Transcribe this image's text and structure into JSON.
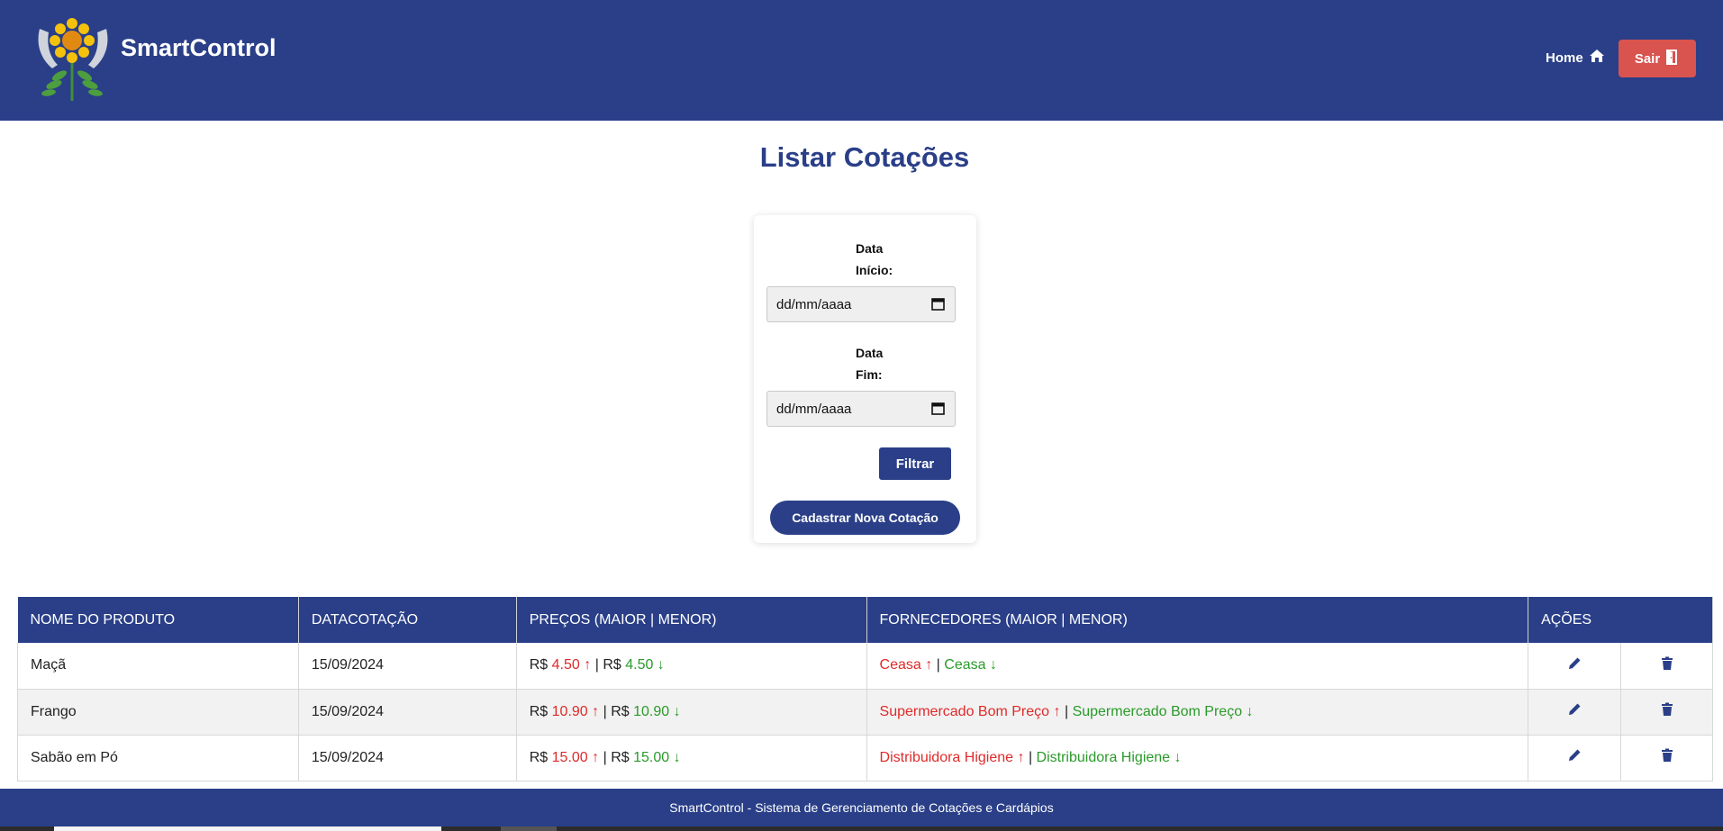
{
  "header": {
    "brand": "SmartControl",
    "home_label": "Home",
    "logout_label": "Sair"
  },
  "page": {
    "title": "Listar Cotações"
  },
  "filter": {
    "start_label_line1": "Data",
    "start_label_line2": "Início:",
    "start_value": "dd/mm/aaaa",
    "end_label_line1": "Data",
    "end_label_line2": "Fim:",
    "end_value": "dd/mm/aaaa",
    "filter_button": "Filtrar",
    "new_button": "Cadastrar Nova Cotação"
  },
  "table": {
    "columns": [
      "NOME DO PRODUTO",
      "DATACOTAÇÃO",
      "PREÇOS (MAIOR | MENOR)",
      "FORNECEDORES (MAIOR | MENOR)",
      "AÇÕES"
    ],
    "rows": [
      {
        "product": "Maçã",
        "date": "15/09/2024",
        "currency": "R$",
        "price_high": "4.50 ↑",
        "sep": "|",
        "price_low": "4.50 ↓",
        "supplier_high": "Ceasa ↑",
        "supplier_low": "Ceasa ↓"
      },
      {
        "product": "Frango",
        "date": "15/09/2024",
        "currency": "R$",
        "price_high": "10.90 ↑",
        "sep": "|",
        "price_low": "10.90 ↓",
        "supplier_high": "Supermercado Bom Preço ↑",
        "supplier_low": "Supermercado Bom Preço ↓"
      },
      {
        "product": "Sabão em Pó",
        "date": "15/09/2024",
        "currency": "R$",
        "price_high": "15.00 ↑",
        "sep": "|",
        "price_low": "15.00 ↓",
        "supplier_high": "Distribuidora Higiene ↑",
        "supplier_low": "Distribuidora Higiene ↓"
      }
    ]
  },
  "footer": {
    "text": "SmartControl - Sistema de Gerenciamento de Cotações e Cardápios"
  },
  "colors": {
    "primary": "#2a3f88",
    "danger": "#d9534f",
    "up": "#e02a2a",
    "down": "#2a9a2a"
  },
  "icons": {
    "logo": "flower-hands-logo",
    "home": "home-icon",
    "logout": "door-exit-icon",
    "calendar": "calendar-icon",
    "edit": "pencil-icon",
    "delete": "trash-icon"
  }
}
